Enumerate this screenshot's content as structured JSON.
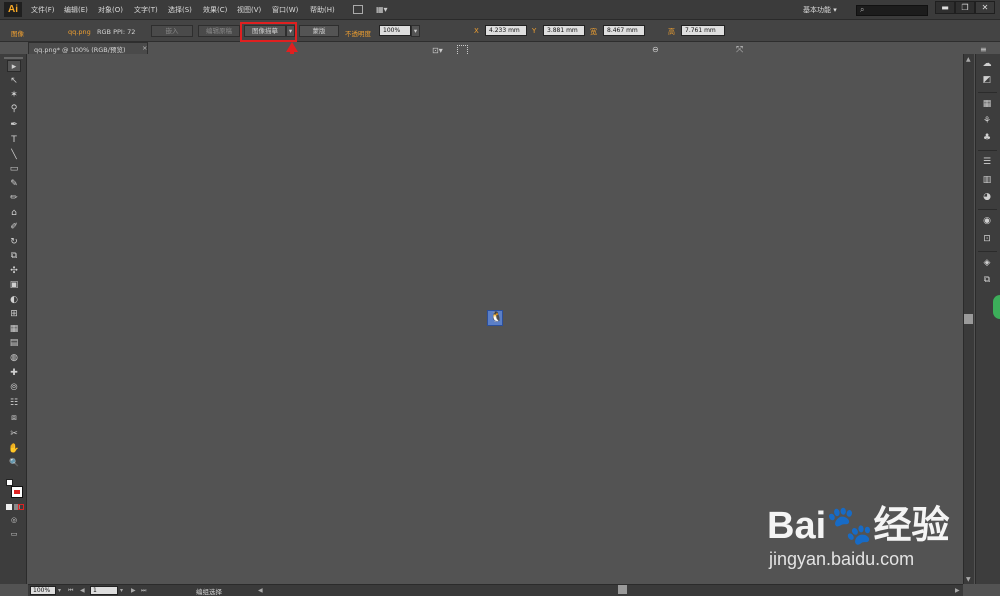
{
  "menubar": {
    "logo": "Ai",
    "items": [
      "文件(F)",
      "编辑(E)",
      "对象(O)",
      "文字(T)",
      "选择(S)",
      "效果(C)",
      "视图(V)",
      "窗口(W)",
      "帮助(H)"
    ],
    "workspace": "基本功能 ▾",
    "search_glyph": "⌕",
    "window_buttons": [
      "▬",
      "❐",
      "✕"
    ]
  },
  "controlbar": {
    "object_type": "图像",
    "filename": "qq.png",
    "color_info": "RGB  PPI: 72",
    "embed_button": "嵌入",
    "edit_original_button": "编辑原稿",
    "image_trace_button": "图像描摹",
    "image_trace_dropdown": "▾",
    "mask_button": "蒙版",
    "opacity_label": "不透明度",
    "opacity_value": "100%",
    "x_label": "X",
    "x_value": "4.233 mm",
    "y_label": "Y",
    "y_value": "3.881 mm",
    "w_label": "宽",
    "w_value": "8.467 mm",
    "h_label": "高",
    "h_value": "7.761 mm"
  },
  "tab": {
    "title": "qq.png* @ 100% (RGB/预览)",
    "close": "×"
  },
  "tools": [
    "▸",
    "↖",
    "✶",
    "⚲",
    "✒",
    "T",
    "╲",
    "▭",
    "✎",
    "✏",
    "⌂",
    "✐",
    "↻",
    "⧉",
    "✣",
    "▣",
    "◐",
    "⊞",
    "▦",
    "▤",
    "◍",
    "✚",
    "⦾",
    "☷",
    "⧈",
    "✂",
    "✋",
    "🔍"
  ],
  "dock_icons": [
    "☁",
    "◩",
    "▦",
    "⚘",
    "♣",
    "☰",
    "▥",
    "◕",
    "◉",
    "⊡",
    "◈",
    "⧉"
  ],
  "placed_image": {
    "glyph": "🐧"
  },
  "status": {
    "zoom": "100%",
    "page": "1",
    "text": "编组选择"
  },
  "watermark": {
    "logo": "Bai🐾经验",
    "url": "jingyan.baidu.com"
  },
  "colors": {
    "accent_orange": "#f0a030",
    "highlight_red": "#e02020",
    "canvas_gray": "#535353"
  }
}
